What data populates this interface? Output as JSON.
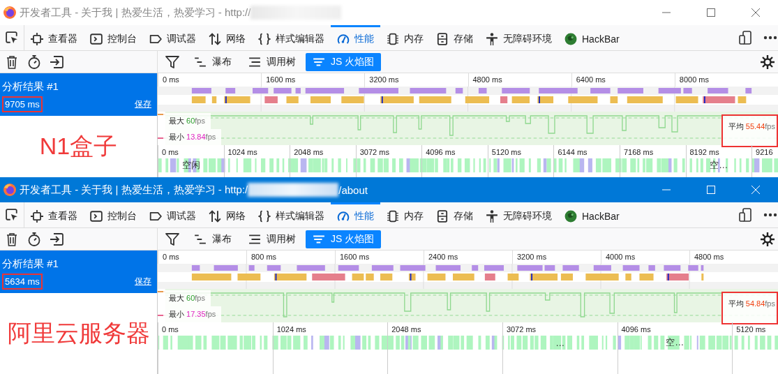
{
  "windows": [
    {
      "title": "开发者工具 - 关于我 | 热爱生活，热爱学习 - http://",
      "active": false,
      "tabs": [
        {
          "label": "查看器",
          "selected": false
        },
        {
          "label": "控制台",
          "selected": false
        },
        {
          "label": "调试器",
          "selected": false
        },
        {
          "label": "网络",
          "selected": false
        },
        {
          "label": "样式编辑器",
          "selected": false
        },
        {
          "label": "性能",
          "selected": true
        },
        {
          "label": "内存",
          "selected": false
        },
        {
          "label": "存储",
          "selected": false
        },
        {
          "label": "无障碍环境",
          "selected": false
        },
        {
          "label": "HackBar",
          "selected": false
        }
      ],
      "views": [
        {
          "label": "瀑布",
          "selected": false
        },
        {
          "label": "调用树",
          "selected": false
        },
        {
          "label": "JS 火焰图",
          "selected": true
        }
      ],
      "recording": {
        "title": "分析结果 #1",
        "duration": "9705 ms",
        "duration_highlighted": true,
        "save": "保存",
        "selected": true
      },
      "annotation": "N1盒子",
      "ticks": [
        "0 ms",
        "1600 ms",
        "3200 ms",
        "4800 ms",
        "6400 ms",
        "8000 ms"
      ],
      "fps": {
        "max": {
          "label": "最大",
          "value": "60",
          "unit": "fps"
        },
        "min": {
          "label": "最小",
          "value": "13.84",
          "unit": "fps"
        },
        "avg": {
          "label": "平均",
          "value": "55.44",
          "unit": "fps"
        },
        "avg_highlighted": true
      },
      "ruler": [
        {
          "label": "0 ms",
          "markers": [
            "空闲"
          ]
        },
        {
          "label": "1024 ms"
        },
        {
          "label": "2048 ms"
        },
        {
          "label": "3072 ms"
        },
        {
          "label": "4096 ms"
        },
        {
          "label": "5120 ms"
        },
        {
          "label": "6144 ms"
        },
        {
          "label": "7168 ms"
        },
        {
          "label": "8192 ms",
          "markers": [
            "空…"
          ]
        },
        {
          "label": "9216"
        }
      ]
    },
    {
      "title": "开发者工具 - 关于我 | 热爱生活，热爱学习 - http:/",
      "title_suffix": "/about",
      "active": true,
      "tabs": [
        {
          "label": "查看器",
          "selected": false
        },
        {
          "label": "控制台",
          "selected": false
        },
        {
          "label": "调试器",
          "selected": false
        },
        {
          "label": "网络",
          "selected": false
        },
        {
          "label": "样式编辑器",
          "selected": false
        },
        {
          "label": "性能",
          "selected": true
        },
        {
          "label": "内存",
          "selected": false
        },
        {
          "label": "存储",
          "selected": false
        },
        {
          "label": "无障碍环境",
          "selected": false
        },
        {
          "label": "HackBar",
          "selected": false
        }
      ],
      "views": [
        {
          "label": "瀑布",
          "selected": false
        },
        {
          "label": "调用树",
          "selected": false
        },
        {
          "label": "JS 火焰图",
          "selected": true
        }
      ],
      "recording": {
        "title": "分析结果 #1",
        "duration": "5634 ms",
        "duration_highlighted": true,
        "save": "保存",
        "selected": true
      },
      "annotation": "阿里云服务器",
      "ticks": [
        "0 ms",
        "800 ms",
        "1600 ms",
        "2400 ms",
        "3200 ms",
        "4000 ms",
        "4800 ms"
      ],
      "fps": {
        "max": {
          "label": "最大",
          "value": "60",
          "unit": "fps"
        },
        "min": {
          "label": "最小",
          "value": "17.35",
          "unit": "fps"
        },
        "avg": {
          "label": "平均",
          "value": "54.84",
          "unit": "fps"
        },
        "avg_highlighted": true
      },
      "ruler": [
        {
          "label": "0 ms"
        },
        {
          "label": "1024 ms"
        },
        {
          "label": "2048 ms"
        },
        {
          "label": "3072 ms",
          "markers": [
            "…"
          ]
        },
        {
          "label": "4096 ms",
          "markers": [
            "空…"
          ]
        },
        {
          "label": "5120 ms"
        }
      ]
    }
  ]
}
